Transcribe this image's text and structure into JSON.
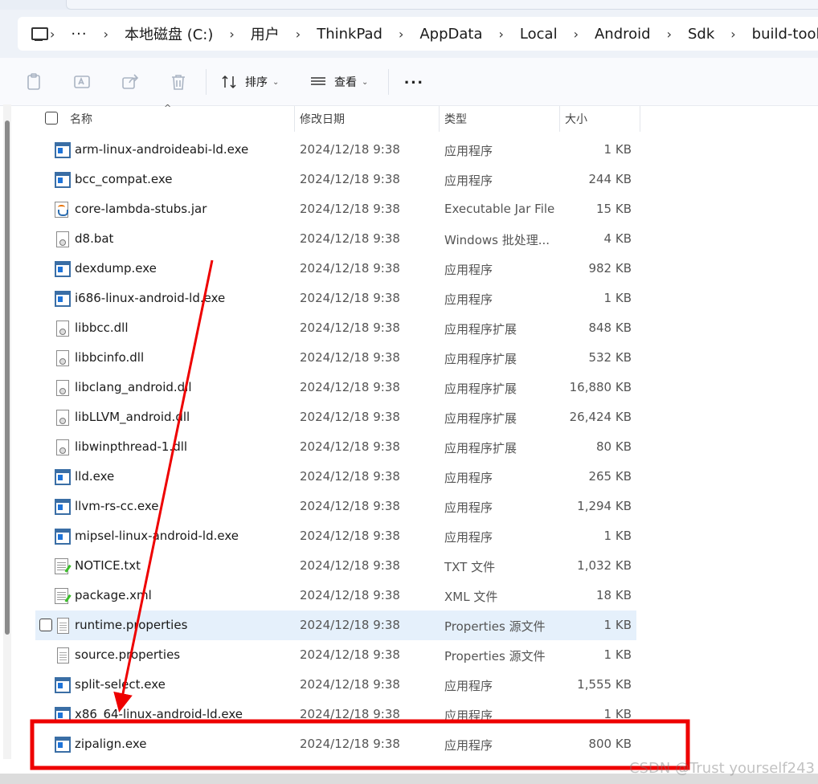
{
  "address": {
    "overflow": "···",
    "crumbs": [
      "本地磁盘 (C:)",
      "用户",
      "ThinkPad",
      "AppData",
      "Local",
      "Android",
      "Sdk",
      "build-tools"
    ]
  },
  "toolbar": {
    "sort_label": "排序",
    "view_label": "查看",
    "more_label": "···"
  },
  "columns": {
    "name": "名称",
    "date": "修改日期",
    "type": "类型",
    "size": "大小"
  },
  "files": [
    {
      "name": "arm-linux-androideabi-ld.exe",
      "date": "2024/12/18 9:38",
      "type": "应用程序",
      "size": "1 KB",
      "icon": "exe-icon"
    },
    {
      "name": "bcc_compat.exe",
      "date": "2024/12/18 9:38",
      "type": "应用程序",
      "size": "244 KB",
      "icon": "exe-icon"
    },
    {
      "name": "core-lambda-stubs.jar",
      "date": "2024/12/18 9:38",
      "type": "Executable Jar File",
      "size": "15 KB",
      "icon": "jar-icon"
    },
    {
      "name": "d8.bat",
      "date": "2024/12/18 9:38",
      "type": "Windows 批处理...",
      "size": "4 KB",
      "icon": "batch-icon"
    },
    {
      "name": "dexdump.exe",
      "date": "2024/12/18 9:38",
      "type": "应用程序",
      "size": "982 KB",
      "icon": "exe-icon"
    },
    {
      "name": "i686-linux-android-ld.exe",
      "date": "2024/12/18 9:38",
      "type": "应用程序",
      "size": "1 KB",
      "icon": "exe-icon"
    },
    {
      "name": "libbcc.dll",
      "date": "2024/12/18 9:38",
      "type": "应用程序扩展",
      "size": "848 KB",
      "icon": "dll-icon"
    },
    {
      "name": "libbcinfo.dll",
      "date": "2024/12/18 9:38",
      "type": "应用程序扩展",
      "size": "532 KB",
      "icon": "dll-icon"
    },
    {
      "name": "libclang_android.dll",
      "date": "2024/12/18 9:38",
      "type": "应用程序扩展",
      "size": "16,880 KB",
      "icon": "dll-icon"
    },
    {
      "name": "libLLVM_android.dll",
      "date": "2024/12/18 9:38",
      "type": "应用程序扩展",
      "size": "26,424 KB",
      "icon": "dll-icon"
    },
    {
      "name": "libwinpthread-1.dll",
      "date": "2024/12/18 9:38",
      "type": "应用程序扩展",
      "size": "80 KB",
      "icon": "dll-icon"
    },
    {
      "name": "lld.exe",
      "date": "2024/12/18 9:38",
      "type": "应用程序",
      "size": "265 KB",
      "icon": "exe-icon"
    },
    {
      "name": "llvm-rs-cc.exe",
      "date": "2024/12/18 9:38",
      "type": "应用程序",
      "size": "1,294 KB",
      "icon": "exe-icon"
    },
    {
      "name": "mipsel-linux-android-ld.exe",
      "date": "2024/12/18 9:38",
      "type": "应用程序",
      "size": "1 KB",
      "icon": "exe-icon"
    },
    {
      "name": "NOTICE.txt",
      "date": "2024/12/18 9:38",
      "type": "TXT 文件",
      "size": "1,032 KB",
      "icon": "txt-icon"
    },
    {
      "name": "package.xml",
      "date": "2024/12/18 9:38",
      "type": "XML 文件",
      "size": "18 KB",
      "icon": "xml-icon"
    },
    {
      "name": "runtime.properties",
      "date": "2024/12/18 9:38",
      "type": "Properties 源文件",
      "size": "1 KB",
      "icon": "properties-icon"
    },
    {
      "name": "source.properties",
      "date": "2024/12/18 9:38",
      "type": "Properties 源文件",
      "size": "1 KB",
      "icon": "properties-icon"
    },
    {
      "name": "split-select.exe",
      "date": "2024/12/18 9:38",
      "type": "应用程序",
      "size": "1,555 KB",
      "icon": "exe-icon"
    },
    {
      "name": "x86_64-linux-android-ld.exe",
      "date": "2024/12/18 9:38",
      "type": "应用程序",
      "size": "1 KB",
      "icon": "exe-icon"
    },
    {
      "name": "zipalign.exe",
      "date": "2024/12/18 9:38",
      "type": "应用程序",
      "size": "800 KB",
      "icon": "exe-icon"
    }
  ],
  "hovered_file": "runtime.properties",
  "highlighted_file": "zipalign.exe",
  "annotation_color": "#ee0000",
  "watermark": "CSDN @Trust yourself243"
}
